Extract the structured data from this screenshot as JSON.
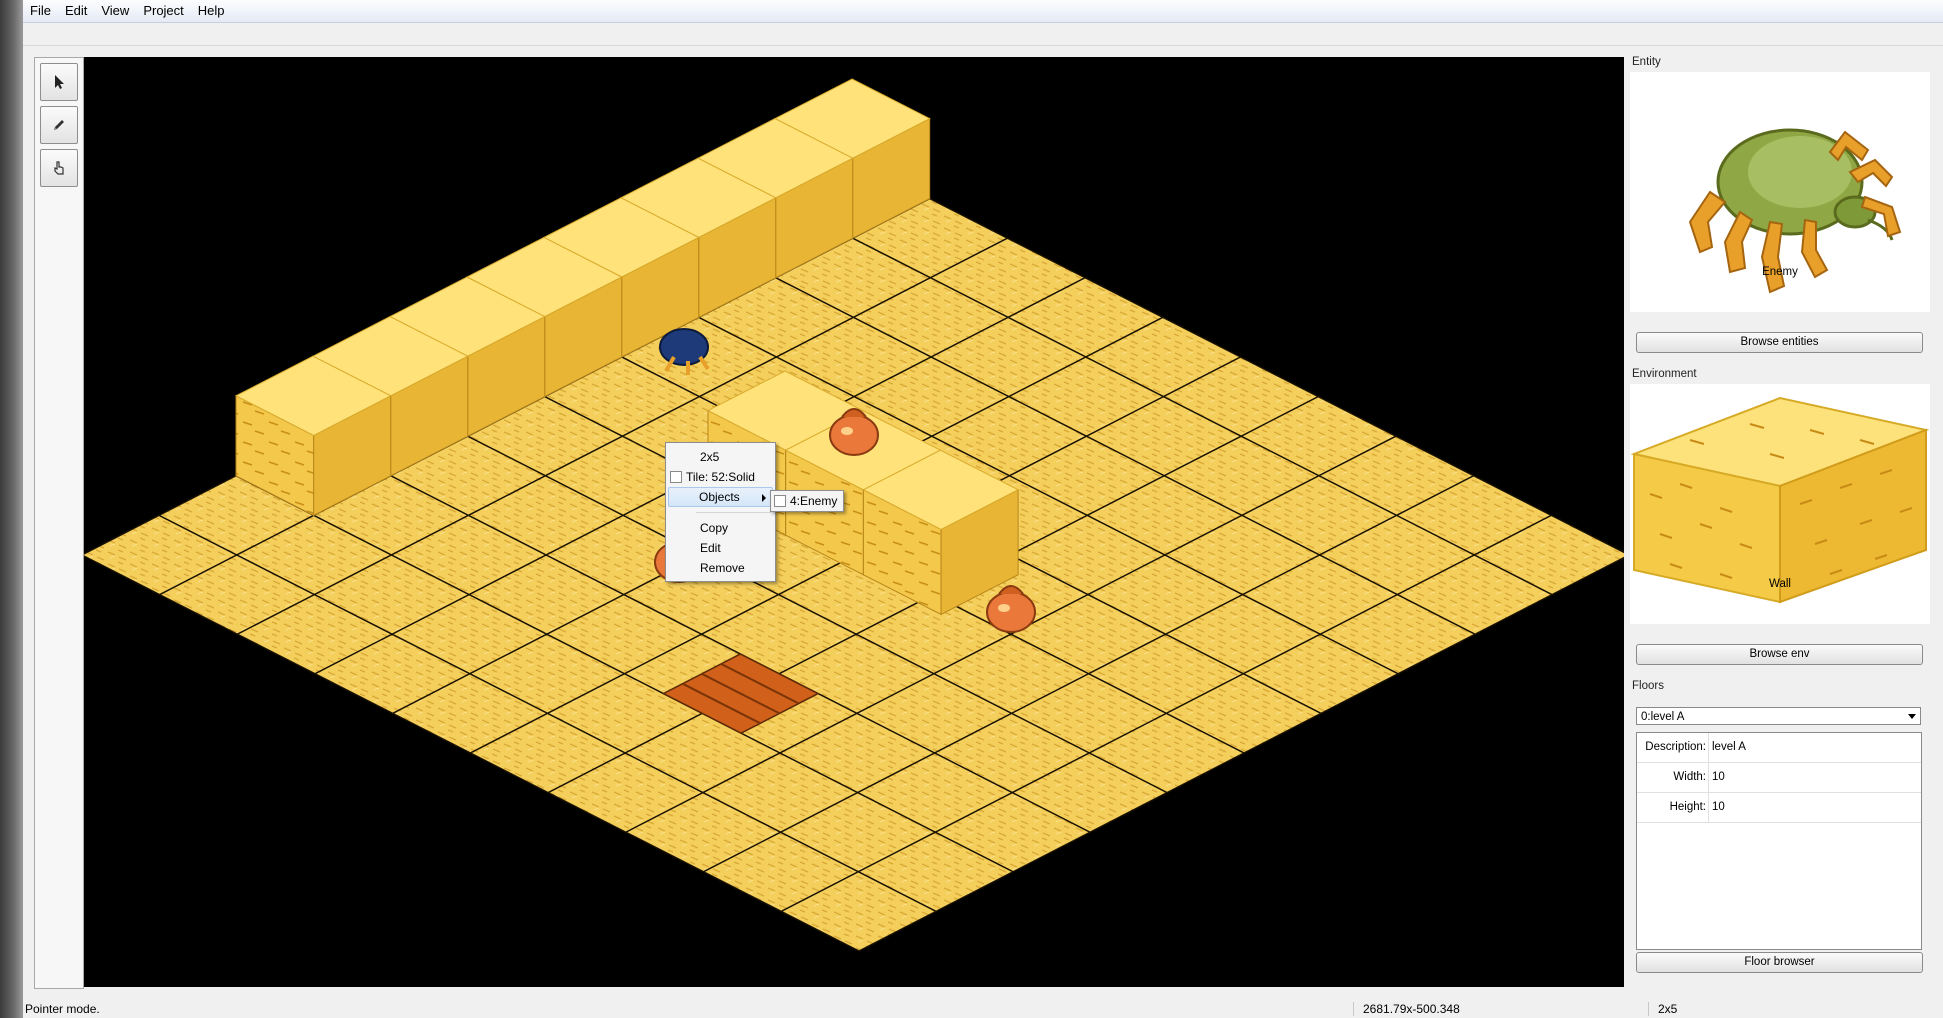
{
  "menu": [
    "File",
    "Edit",
    "View",
    "Project",
    "Help"
  ],
  "tools": [
    {
      "name": "pointer-tool",
      "icon": "cursor-arrow-icon"
    },
    {
      "name": "pencil-tool",
      "icon": "pencil-icon"
    },
    {
      "name": "stamp-tool",
      "icon": "hand-pointer-icon"
    }
  ],
  "context_menu": {
    "title": "2x5",
    "tile": "Tile: 52:Solid",
    "objects": "Objects",
    "submenu_item": "4:Enemy",
    "copy": "Copy",
    "edit": "Edit",
    "remove": "Remove"
  },
  "entity": {
    "group_title": "Entity",
    "name": "Enemy",
    "browse": "Browse entities",
    "icon": "beetle-enemy-icon"
  },
  "environment": {
    "group_title": "Environment",
    "name": "Wall",
    "browse": "Browse env",
    "icon": "brick-wall-block-icon"
  },
  "floors": {
    "group_title": "Floors",
    "selected": "0:level A",
    "properties": [
      {
        "key": "Description:",
        "value": "level A"
      },
      {
        "key": "Width:",
        "value": "10"
      },
      {
        "key": "Height:",
        "value": "10"
      }
    ],
    "browse": "Floor browser"
  },
  "status": {
    "mode": "Pointer mode.",
    "coords": "2681.79x-500.348",
    "tile": "2x5"
  },
  "colors": {
    "floor": "#f5cf5c",
    "floor_light": "#fbe08a",
    "grid_line": "#1a1200",
    "wall_top": "#ffe27a",
    "wall_left": "#f3c84b",
    "wall_right": "#e8b634",
    "stairs": "#d0601a"
  }
}
